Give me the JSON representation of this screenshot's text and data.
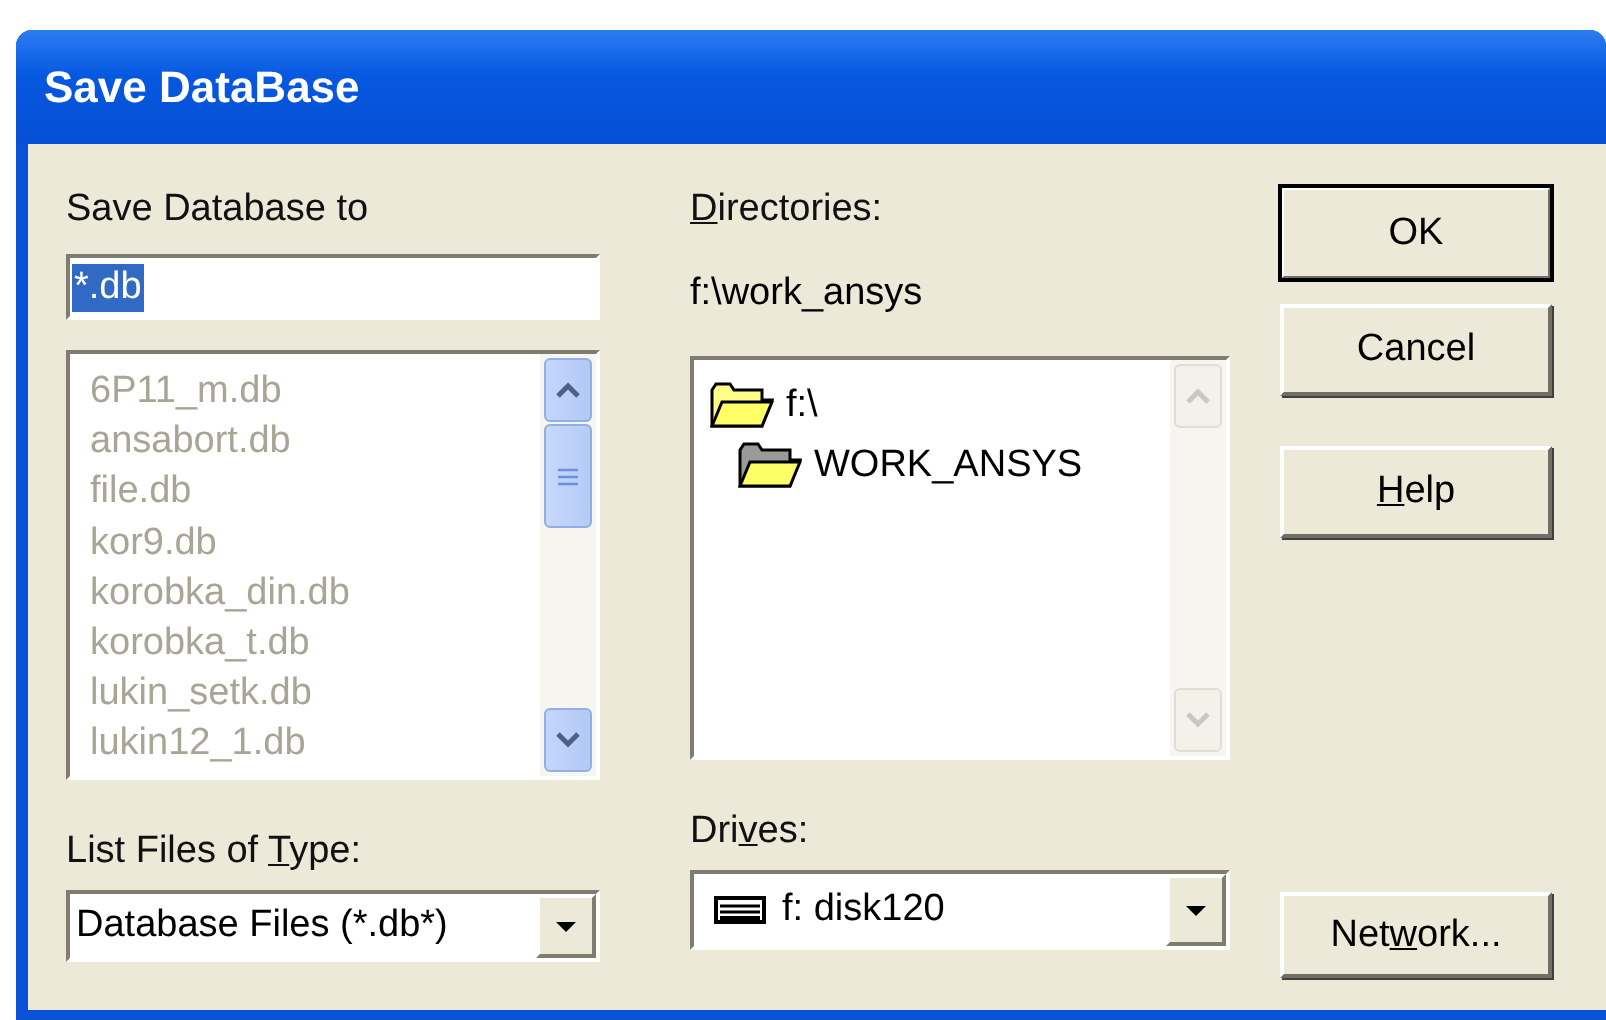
{
  "window": {
    "title": "Save DataBase"
  },
  "save_to": {
    "label": "Save Database to",
    "value": "*.db",
    "value_selected": true
  },
  "files": {
    "disabled": true,
    "items": [
      {
        "name": "6P11_m.db"
      },
      {
        "name": "ansabort.db"
      },
      {
        "name": "file.db"
      },
      {
        "name": "kor9.db"
      },
      {
        "name": "korobka_din.db"
      },
      {
        "name": "korobka_t.db"
      },
      {
        "name": "lukin_setk.db"
      },
      {
        "name": "lukin12_1.db"
      }
    ]
  },
  "file_type": {
    "label": {
      "before": "List Files of ",
      "key": "T",
      "after": "ype:"
    },
    "value": "Database Files (*.db*)"
  },
  "directories": {
    "label": {
      "key": "D",
      "after": "irectories:"
    },
    "path": "f:\\work_ansys",
    "tree": [
      {
        "label": "f:\\",
        "children": [
          {
            "label": "WORK_ANSYS"
          }
        ]
      }
    ]
  },
  "drives": {
    "label": {
      "before": "Dri",
      "key": "v",
      "after": "es:"
    },
    "value": "f: disk120"
  },
  "buttons": [
    {
      "kind": "default",
      "label": {
        "before": "OK"
      }
    },
    {
      "kind": "normal",
      "label": {
        "before": "Cancel"
      }
    },
    {
      "kind": "normal",
      "label": {
        "key": "H",
        "after": "elp"
      }
    }
  ],
  "network_button": {
    "label": {
      "before": "Net",
      "key": "w",
      "after": "ork..."
    }
  }
}
